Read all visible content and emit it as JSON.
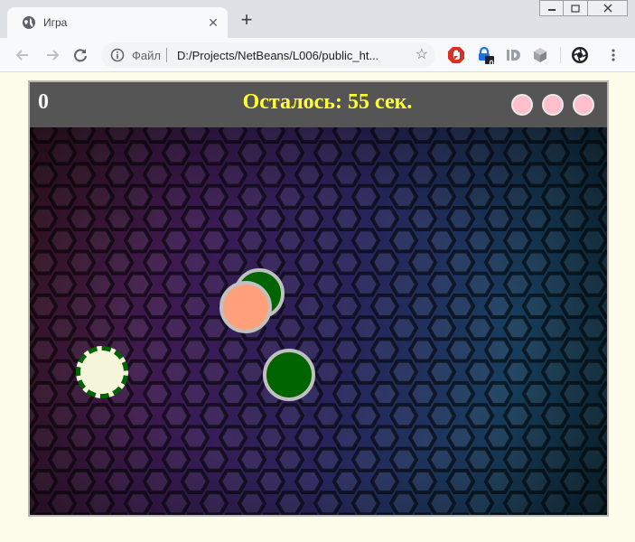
{
  "browser": {
    "tab_title": "Игра",
    "tab_close": "✕",
    "new_tab": "+",
    "omnibox": {
      "scheme_label": "Файл",
      "url": "D:/Projects/NetBeans/L006/public_ht..."
    },
    "extensions": [
      "adblock-icon",
      "password-icon",
      "id-icon",
      "cube-icon",
      "aperture-icon"
    ],
    "extension_badge": "0"
  },
  "game": {
    "score": "0",
    "timer_text": "Осталось: 55 сек.",
    "lives": [
      {
        "color": "#ffc0cb"
      },
      {
        "color": "#ffc0cb"
      },
      {
        "color": "#ffc0cb"
      }
    ],
    "colors": {
      "hud_background": "#555555",
      "timer": "#ffff33",
      "life": "#ffc0cb",
      "ball_green": "#006400",
      "ball_salmon": "#ffa07a",
      "ball_player": "#f5f5dc"
    },
    "balls": [
      {
        "kind": "green",
        "color": "#006400",
        "border": "#c0c0c0"
      },
      {
        "kind": "salmon",
        "color": "#ffa07a",
        "border": "#c0c0c0"
      },
      {
        "kind": "green",
        "color": "#006400",
        "border": "#c0c0c0"
      },
      {
        "kind": "player",
        "color": "#f5f5dc",
        "border": "#006400",
        "border_style": "dashed"
      }
    ]
  }
}
